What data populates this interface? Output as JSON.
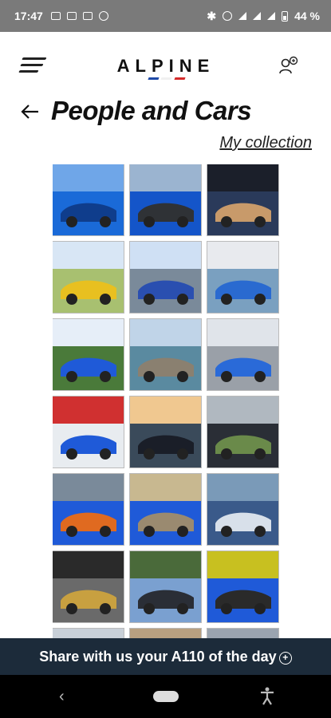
{
  "status_bar": {
    "time": "17:47",
    "battery": "44 %"
  },
  "header": {
    "logo": "ALPINE",
    "logo_colors": [
      "#1e4aa8",
      "#ffffff",
      "#d42a2a"
    ]
  },
  "page": {
    "title": "People and Cars",
    "collection_link": "My collection"
  },
  "gallery": {
    "photos": [
      {
        "subject": "blue car front close-up",
        "colors": [
          "#1a6ad8",
          "#0f3d8c",
          "#6fa6e8"
        ]
      },
      {
        "subject": "blue car headlight",
        "colors": [
          "#1455c9",
          "#2f3236",
          "#9bb4d0"
        ]
      },
      {
        "subject": "car headlight detail",
        "colors": [
          "#2a3a5a",
          "#c89a6a",
          "#1b1f2a"
        ]
      },
      {
        "subject": "yellow car on hill",
        "colors": [
          "#a8c070",
          "#e8c020",
          "#d8e6f5"
        ]
      },
      {
        "subject": "cars on track",
        "colors": [
          "#7a8a9a",
          "#2a4fb0",
          "#cfe0f4"
        ]
      },
      {
        "subject": "white and blue cars",
        "colors": [
          "#7aa0c0",
          "#2a6ad0",
          "#e8eaee"
        ]
      },
      {
        "subject": "two blue cars in village",
        "colors": [
          "#4a7a3a",
          "#1f5ad8",
          "#e6eef8"
        ]
      },
      {
        "subject": "lake and wall",
        "colors": [
          "#5a8aa0",
          "#8a8070",
          "#c0d4e8"
        ]
      },
      {
        "subject": "blue car rear",
        "colors": [
          "#9aa0a8",
          "#2a6ad8",
          "#e0e4ea"
        ]
      },
      {
        "subject": "white car with stripes",
        "colors": [
          "#e8ecf0",
          "#1f5ad8",
          "#d03030"
        ]
      },
      {
        "subject": "dark car at sunset",
        "colors": [
          "#3a4a5a",
          "#1a1e28",
          "#f0c890"
        ]
      },
      {
        "subject": "dark car detail",
        "colors": [
          "#2a2e36",
          "#6a8a4a",
          "#b0b8c0"
        ]
      },
      {
        "subject": "blue orange car in garage",
        "colors": [
          "#1f5ad8",
          "#e06a20",
          "#7a8a9a"
        ]
      },
      {
        "subject": "blue car in street",
        "colors": [
          "#1f5ad8",
          "#9a8a70",
          "#c8b890"
        ]
      },
      {
        "subject": "blue car rear detail",
        "colors": [
          "#3a5a8a",
          "#d8e0ea",
          "#7a9ab8"
        ]
      },
      {
        "subject": "grey car in garage",
        "colors": [
          "#6a6a6a",
          "#c8a040",
          "#2a2a2a"
        ]
      },
      {
        "subject": "dark car in mountains",
        "colors": [
          "#7aa0d0",
          "#2a2e36",
          "#4a6a3a"
        ]
      },
      {
        "subject": "car interior seat",
        "colors": [
          "#1f5ad8",
          "#2a2a2a",
          "#c8c020"
        ]
      }
    ]
  },
  "banner": {
    "text": "Share with us your A110 of the day"
  }
}
